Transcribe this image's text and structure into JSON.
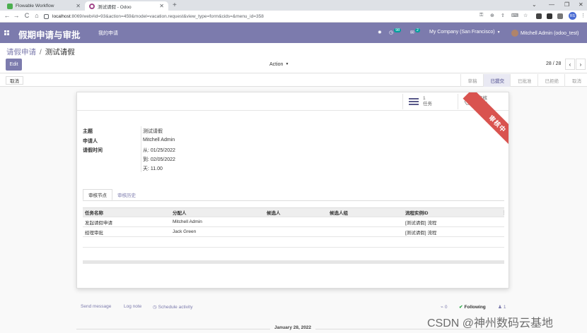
{
  "browser": {
    "tabs": [
      {
        "title": "Flowable Workflow",
        "favicon_color": "#4caf50"
      },
      {
        "title": "测试请假 - Odoo",
        "favicon_color": "#a24689"
      }
    ],
    "new_tab": "+",
    "window_controls": [
      "⌄",
      "—",
      "❐",
      "✕"
    ],
    "url_host": "localhost",
    "url_path": ":8069/web#id=93&action=459&model=vacation.request&view_type=form&cids=&menu_id=358",
    "nav": {
      "back": "←",
      "forward": "→",
      "reload": "C",
      "home": "⌂"
    },
    "profile_initials": "RS"
  },
  "navbar": {
    "app_title": "假期申请与审批",
    "menu_item": "我的申请",
    "chat_badge": "98",
    "activity_badge": "2",
    "company": "My Company (San Francisco)",
    "user": "Mitchell Admin (odoo_test)"
  },
  "control_panel": {
    "breadcrumb_parent": "请假申请",
    "breadcrumb_sep": "/",
    "breadcrumb_current": "测试请假",
    "edit_label": "Edit",
    "action_label": "Action",
    "pager": "28 / 28",
    "prev": "‹",
    "next": "›"
  },
  "statusbar": {
    "cancel_label": "取消",
    "stages": [
      "草稿",
      "已提交",
      "已批准",
      "已拒绝",
      "取消"
    ],
    "current_stage": "已提交"
  },
  "sheet": {
    "stat_tasks_count": "1",
    "stat_tasks_label": "任务",
    "stat_flow_line1": "审核",
    "stat_flow_line2": "流程",
    "ribbon": "审核中",
    "fields": {
      "subject_label": "主题",
      "subject_value": "测试请假",
      "applicant_label": "申请人",
      "applicant_value": "Mitchell Admin",
      "time_label": "请假时间",
      "from_value": "从: 01/25/2022",
      "to_value": "到: 02/05/2022",
      "days_value": "天: 11.00"
    },
    "tabs": [
      "审核节点",
      "审核历史"
    ],
    "table": {
      "headers": [
        "任务名称",
        "分配人",
        "候选人",
        "候选人组",
        "流程实例ID",
        "⋮"
      ],
      "rows": [
        [
          "发起请假申请",
          "Mitchell Admin",
          "",
          "",
          "[测试请假] 流程"
        ],
        [
          "经理审批",
          "Jack Green",
          "",
          "",
          "[测试请假] 流程"
        ]
      ]
    }
  },
  "chatter": {
    "send_message": "Send message",
    "log_note": "Log note",
    "schedule_activity": "Schedule activity",
    "attachments": "0",
    "following": "Following",
    "followers": "1",
    "date_separator": "January 28, 2022"
  },
  "watermark": "CSDN @神州数码云基地"
}
